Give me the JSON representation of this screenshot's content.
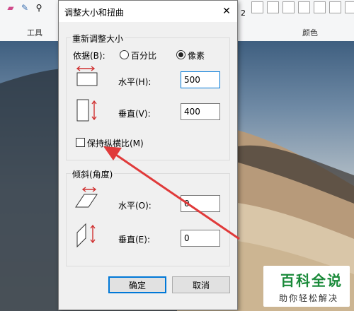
{
  "dialog": {
    "title": "调整大小和扭曲",
    "resize_group": {
      "title": "重新调整大小",
      "by_label": "依据(B):",
      "percent_label": "百分比",
      "pixels_label": "像素",
      "selected": "pixels",
      "horizontal_label": "水平(H):",
      "horizontal_value": "500",
      "vertical_label": "垂直(V):",
      "vertical_value": "400",
      "keep_ratio_label": "保持纵横比(M)",
      "keep_ratio_checked": false
    },
    "skew_group": {
      "title": "倾斜(角度)",
      "horizontal_label": "水平(O):",
      "horizontal_value": "0",
      "vertical_label": "垂直(E):",
      "vertical_value": "0"
    },
    "ok_label": "确定",
    "cancel_label": "取消"
  },
  "ribbon": {
    "tools_label": "工具",
    "size_value": "2",
    "colors_label": "颜色"
  },
  "watermark": {
    "title": "百科全说",
    "subtitle": "助你轻松解决"
  },
  "colors": {
    "annotation_arrow": "#e03a3a",
    "focus_blue": "#0078d7"
  }
}
